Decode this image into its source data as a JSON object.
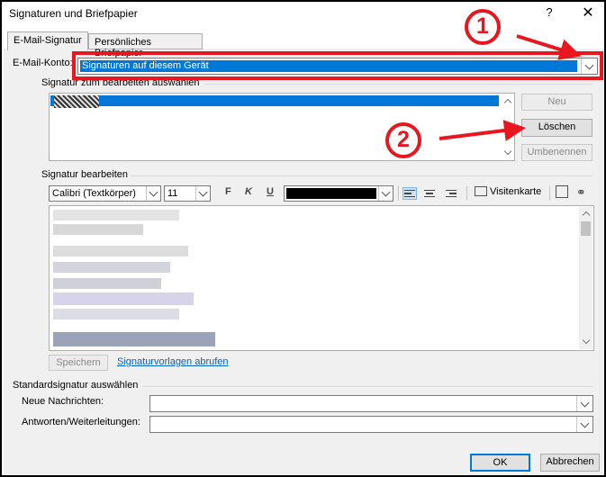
{
  "window": {
    "title": "Signaturen und Briefpapier",
    "help": "?",
    "close": "✕"
  },
  "tabs": [
    {
      "label": "E-Mail-Signatur",
      "active": true
    },
    {
      "label": "Persönliches Briefpapier",
      "active": false
    }
  ],
  "account": {
    "label": "E-Mail-Konto:",
    "value": "Signaturen auf diesem Gerät"
  },
  "signature_list": {
    "label": "Signatur zum bearbeiten auswählen",
    "buttons": {
      "new": "Neu",
      "delete": "Löschen",
      "rename": "Umbenennen"
    }
  },
  "editor": {
    "label": "Signatur bearbeiten",
    "font": "Calibri (Textkörper)",
    "size": "11",
    "bold": "F",
    "italic": "K",
    "underline": "U",
    "vcard": "Visitenkarte",
    "save": "Speichern",
    "templates_link": "Signaturvorlagen abrufen"
  },
  "defaults": {
    "label": "Standardsignatur auswählen",
    "new_messages": "Neue Nachrichten:",
    "replies": "Antworten/Weiterleitungen:"
  },
  "footer": {
    "ok": "OK",
    "cancel": "Abbrechen"
  },
  "annotations": {
    "one": "1",
    "two": "2",
    "color": "#e8161f"
  }
}
